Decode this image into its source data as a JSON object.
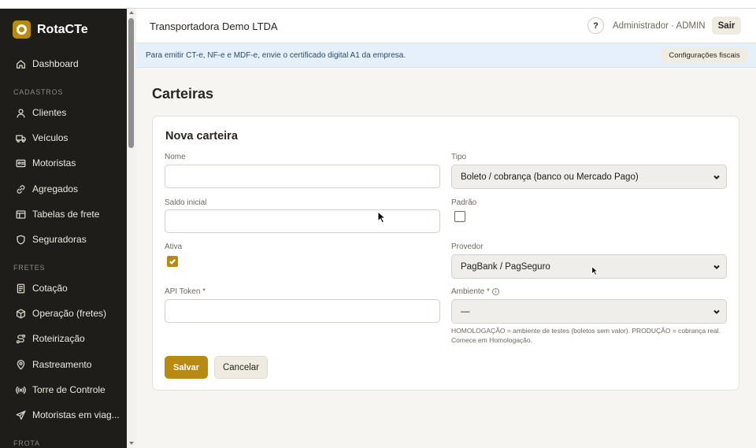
{
  "app": {
    "brand": "RotaCTe"
  },
  "sidebar": {
    "items": [
      {
        "label": "Dashboard",
        "icon": "home-icon"
      },
      {
        "label": "Clientes",
        "icon": "user-icon"
      },
      {
        "label": "Veículos",
        "icon": "truck-icon"
      },
      {
        "label": "Motoristas",
        "icon": "id-card-icon"
      },
      {
        "label": "Agregados",
        "icon": "link-icon"
      },
      {
        "label": "Tabelas de frete",
        "icon": "table-icon"
      },
      {
        "label": "Seguradoras",
        "icon": "shield-icon"
      },
      {
        "label": "Cotação",
        "icon": "document-icon"
      },
      {
        "label": "Operação (fretes)",
        "icon": "box-icon"
      },
      {
        "label": "Roteirização",
        "icon": "route-icon"
      },
      {
        "label": "Rastreamento",
        "icon": "map-pin-icon"
      },
      {
        "label": "Torre de Controle",
        "icon": "radio-tower-icon"
      },
      {
        "label": "Motoristas em viag...",
        "icon": "send-icon"
      }
    ],
    "sections": {
      "cadastros": "CADASTROS",
      "fretes": "FRETES",
      "frota": "FROTA"
    }
  },
  "header": {
    "company": "Transportadora Demo LTDA",
    "help": "?",
    "user": "Administrador · ADMIN",
    "logout": "Sair"
  },
  "alert": {
    "text": "Para emitir CT-e, NF-e e MDF-e, envie o certificado digital A1 da empresa.",
    "button": "Configurações fiscais"
  },
  "page": {
    "title": "Carteiras"
  },
  "form": {
    "title": "Nova carteira",
    "nome_label": "Nome",
    "nome_value": "",
    "tipo_label": "Tipo",
    "tipo_value": "Boleto / cobrança (banco ou Mercado Pago)",
    "saldo_label": "Saldo inicial",
    "saldo_value": "",
    "padrao_label": "Padrão",
    "padrao_checked": false,
    "ativa_label": "Ativa",
    "ativa_checked": true,
    "provedor_label": "Provedor",
    "provedor_value": "PagBank / PagSeguro",
    "token_label": "API Token *",
    "token_value": "",
    "ambiente_label": "Ambiente *",
    "ambiente_info": "i",
    "ambiente_value": "—",
    "ambiente_help": "HOMOLOGAÇÃO = ambiente de testes (boletos sem valor). PRODUÇÃO = cobrança real. Comece em Homologação.",
    "save": "Salvar",
    "cancel": "Cancelar"
  },
  "colors": {
    "accent": "#b88a12",
    "sidebar_bg": "#1f1d1a",
    "alert_bg": "#e6f0fa"
  }
}
